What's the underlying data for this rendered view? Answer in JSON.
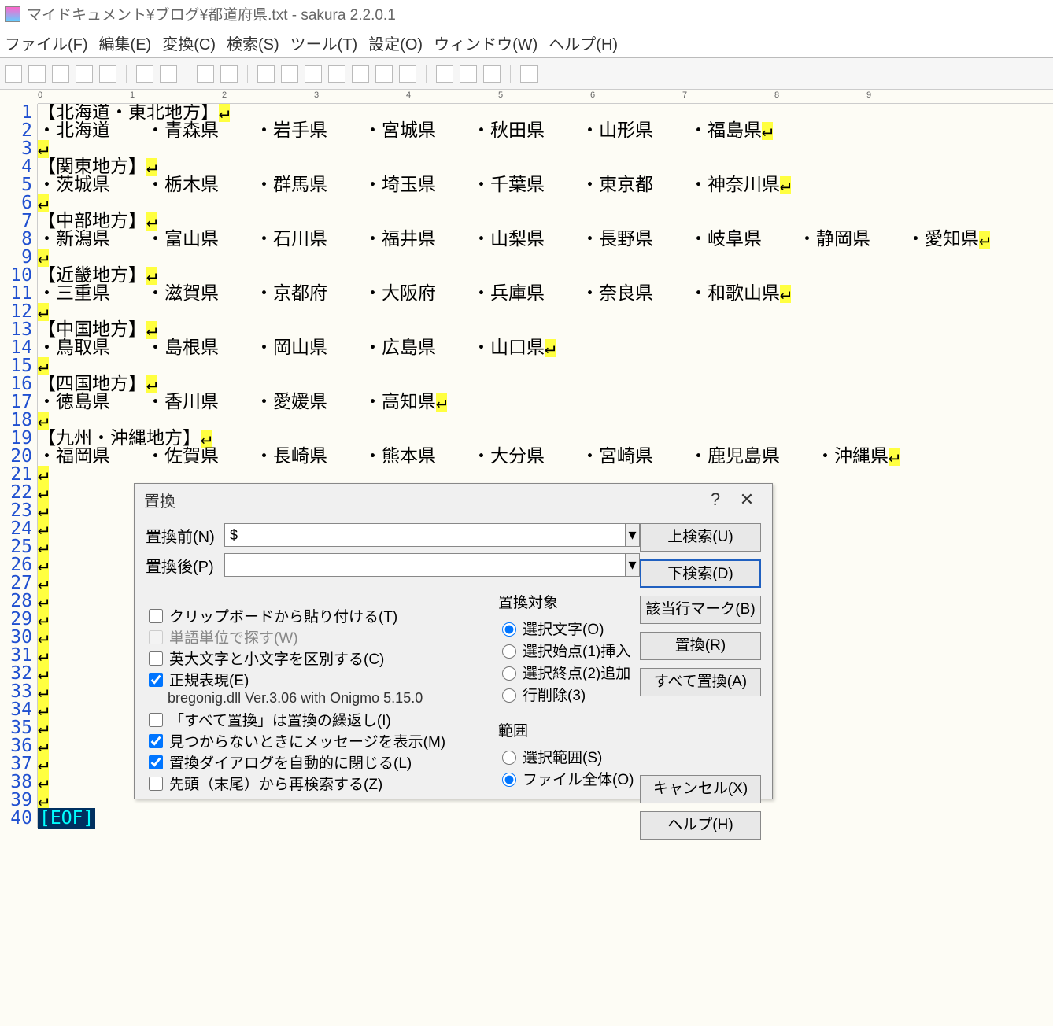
{
  "window_title": "マイドキュメント¥ブログ¥都道府県.txt - sakura 2.2.0.1",
  "menu": [
    "ファイル(F)",
    "編集(E)",
    "変換(C)",
    "検索(S)",
    "ツール(T)",
    "設定(O)",
    "ウィンドウ(W)",
    "ヘルプ(H)"
  ],
  "ruler_marks": [
    "0",
    "1",
    "2",
    "3",
    "4",
    "5",
    "6",
    "7",
    "8",
    "9"
  ],
  "line_count": 40,
  "lines": [
    "【北海道・東北地方】",
    "・北海道　　・青森県　　・岩手県　　・宮城県　　・秋田県　　・山形県　　・福島県",
    "",
    "【関東地方】",
    "・茨城県　　・栃木県　　・群馬県　　・埼玉県　　・千葉県　　・東京都　　・神奈川県",
    "",
    "【中部地方】",
    "・新潟県　　・富山県　　・石川県　　・福井県　　・山梨県　　・長野県　　・岐阜県　　・静岡県　　・愛知県",
    "",
    "【近畿地方】",
    "・三重県　　・滋賀県　　・京都府　　・大阪府　　・兵庫県　　・奈良県　　・和歌山県",
    "",
    "【中国地方】",
    "・鳥取県　　・島根県　　・岡山県　　・広島県　　・山口県",
    "",
    "【四国地方】",
    "・徳島県　　・香川県　　・愛媛県　　・高知県",
    "",
    "【九州・沖縄地方】",
    "・福岡県　　・佐賀県　　・長崎県　　・熊本県　　・大分県　　・宮崎県　　・鹿児島県　　・沖縄県",
    "",
    "",
    "",
    "",
    "",
    "",
    "",
    "",
    "",
    "",
    "",
    "",
    "",
    "",
    "",
    "",
    "",
    "",
    "",
    ""
  ],
  "eol_mark": "↵",
  "eof_mark": "[EOF]",
  "dialog": {
    "title": "置換",
    "help_char": "?",
    "close_char": "✕",
    "before_label": "置換前(N)",
    "before_value": "$",
    "after_label": "置換後(P)",
    "after_value": "",
    "buttons": {
      "up_search": "上検索(U)",
      "down_search": "下検索(D)",
      "mark": "該当行マーク(B)",
      "replace": "置換(R)",
      "replace_all": "すべて置換(A)",
      "cancel": "キャンセル(X)",
      "help": "ヘルプ(H)"
    },
    "checks": {
      "clipboard": "クリップボードから貼り付ける(T)",
      "word": "単語単位で探す(W)",
      "case": "英大文字と小文字を区別する(C)",
      "regex": "正規表現(E)",
      "regex_info": "bregonig.dll Ver.3.06 with Onigmo 5.15.0",
      "repeat": "「すべて置換」は置換の繰返し(I)",
      "msg": "見つからないときにメッセージを表示(M)",
      "autoclose": "置換ダイアログを自動的に閉じる(L)",
      "wrap": "先頭（末尾）から再検索する(Z)"
    },
    "target_title": "置換対象",
    "target_opts": [
      "選択文字(O)",
      "選択始点(1)挿入",
      "選択終点(2)追加",
      "行削除(3)"
    ],
    "range_title": "範囲",
    "range_opts": [
      "選択範囲(S)",
      "ファイル全体(O)"
    ]
  }
}
